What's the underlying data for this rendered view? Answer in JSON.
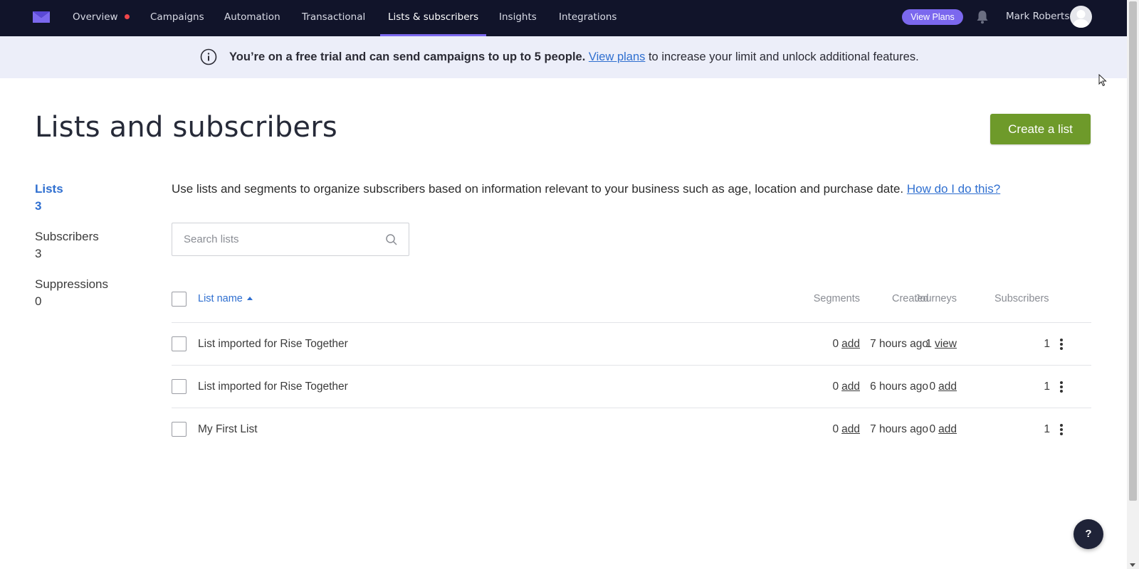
{
  "nav": {
    "items": [
      {
        "label": "Overview",
        "has_dot": true
      },
      {
        "label": "Campaigns"
      },
      {
        "label": "Automation"
      },
      {
        "label": "Transactional"
      },
      {
        "label": "Lists & subscribers",
        "active": true
      },
      {
        "label": "Insights"
      },
      {
        "label": "Integrations"
      }
    ],
    "view_plans_label": "View Plans",
    "user_name": "Mark Roberts",
    "icons": [
      "logo-icon",
      "bell-icon",
      "avatar"
    ],
    "accent_color": "#7b68ee"
  },
  "banner": {
    "bold_text": "You’re on a free trial and can send campaigns to up to 5 people.",
    "link_text": "View plans",
    "rest_text": " to increase your limit and unlock additional features."
  },
  "page": {
    "title": "Lists and subscribers",
    "create_button": "Create a list",
    "create_button_color": "#6e9a2a"
  },
  "stats": [
    {
      "label": "Lists",
      "value": "3",
      "active": true
    },
    {
      "label": "Subscribers",
      "value": "3"
    },
    {
      "label": "Suppressions",
      "value": "0"
    }
  ],
  "intro": {
    "text": "Use lists and segments to organize subscribers based on information relevant to your business such as age, location and purchase date. ",
    "link": "How do I do this?"
  },
  "search": {
    "placeholder": "Search lists",
    "value": ""
  },
  "table": {
    "headers": {
      "name": "List name",
      "segments": "Segments",
      "journeys": "Journeys",
      "created": "Created",
      "subscribers": "Subscribers"
    },
    "rows": [
      {
        "name": "List imported for Rise Together",
        "segments_count": "0",
        "segments_link": "add",
        "journeys_count": "1",
        "journeys_link": "view",
        "created": "7 hours ago",
        "subscribers": "1"
      },
      {
        "name": "List imported for Rise Together",
        "segments_count": "0",
        "segments_link": "add",
        "journeys_count": "0",
        "journeys_link": "add",
        "created": "6 hours ago",
        "subscribers": "1"
      },
      {
        "name": "My First List",
        "segments_count": "0",
        "segments_link": "add",
        "journeys_count": "0",
        "journeys_link": "add",
        "created": "7 hours ago",
        "subscribers": "1"
      }
    ]
  },
  "help_label": "?"
}
